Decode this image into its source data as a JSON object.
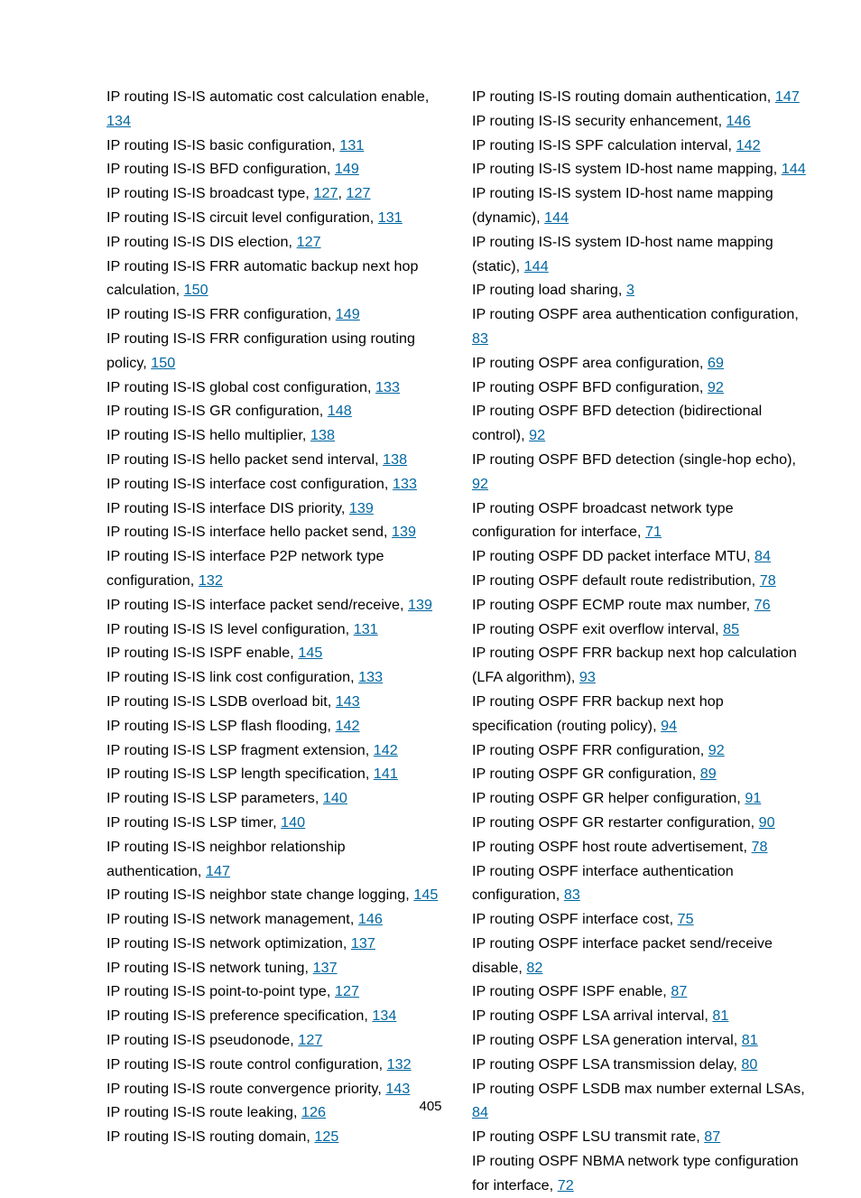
{
  "page_number": "405",
  "left": [
    {
      "text": "IP routing IS-IS automatic cost calculation enable, ",
      "refs": [
        "134"
      ]
    },
    {
      "text": "IP routing IS-IS basic configuration, ",
      "refs": [
        "131"
      ]
    },
    {
      "text": "IP routing IS-IS BFD configuration, ",
      "refs": [
        "149"
      ]
    },
    {
      "text": "IP routing IS-IS broadcast type, ",
      "refs": [
        "127",
        "127"
      ]
    },
    {
      "text": "IP routing IS-IS circuit level configuration, ",
      "refs": [
        "131"
      ]
    },
    {
      "text": "IP routing IS-IS DIS election, ",
      "refs": [
        "127"
      ]
    },
    {
      "text": "IP routing IS-IS FRR automatic backup next hop calculation, ",
      "refs": [
        "150"
      ]
    },
    {
      "text": "IP routing IS-IS FRR configuration, ",
      "refs": [
        "149"
      ]
    },
    {
      "text": "IP routing IS-IS FRR configuration using routing policy, ",
      "refs": [
        "150"
      ]
    },
    {
      "text": "IP routing IS-IS global cost configuration, ",
      "refs": [
        "133"
      ]
    },
    {
      "text": "IP routing IS-IS GR configuration, ",
      "refs": [
        "148"
      ]
    },
    {
      "text": "IP routing IS-IS hello multiplier, ",
      "refs": [
        "138"
      ]
    },
    {
      "text": "IP routing IS-IS hello packet send interval, ",
      "refs": [
        "138"
      ]
    },
    {
      "text": "IP routing IS-IS interface cost configuration, ",
      "refs": [
        "133"
      ]
    },
    {
      "text": "IP routing IS-IS interface DIS priority, ",
      "refs": [
        "139"
      ]
    },
    {
      "text": "IP routing IS-IS interface hello packet send, ",
      "refs": [
        "139"
      ]
    },
    {
      "text": "IP routing IS-IS interface P2P network type configuration, ",
      "refs": [
        "132"
      ]
    },
    {
      "text": "IP routing IS-IS interface packet send/receive, ",
      "refs": [
        "139"
      ]
    },
    {
      "text": "IP routing IS-IS IS level configuration, ",
      "refs": [
        "131"
      ]
    },
    {
      "text": "IP routing IS-IS ISPF enable, ",
      "refs": [
        "145"
      ]
    },
    {
      "text": "IP routing IS-IS link cost configuration, ",
      "refs": [
        "133"
      ]
    },
    {
      "text": "IP routing IS-IS LSDB overload bit, ",
      "refs": [
        "143"
      ]
    },
    {
      "text": "IP routing IS-IS LSP flash flooding, ",
      "refs": [
        "142"
      ]
    },
    {
      "text": "IP routing IS-IS LSP fragment extension, ",
      "refs": [
        "142"
      ]
    },
    {
      "text": "IP routing IS-IS LSP length specification, ",
      "refs": [
        "141"
      ]
    },
    {
      "text": "IP routing IS-IS LSP parameters, ",
      "refs": [
        "140"
      ]
    },
    {
      "text": "IP routing IS-IS LSP timer, ",
      "refs": [
        "140"
      ]
    },
    {
      "text": "IP routing IS-IS neighbor relationship authentication, ",
      "refs": [
        "147"
      ]
    },
    {
      "text": "IP routing IS-IS neighbor state change logging, ",
      "refs": [
        "145"
      ]
    },
    {
      "text": "IP routing IS-IS network management, ",
      "refs": [
        "146"
      ]
    },
    {
      "text": "IP routing IS-IS network optimization, ",
      "refs": [
        "137"
      ]
    },
    {
      "text": "IP routing IS-IS network tuning, ",
      "refs": [
        "137"
      ]
    },
    {
      "text": "IP routing IS-IS point-to-point type, ",
      "refs": [
        "127"
      ]
    },
    {
      "text": "IP routing IS-IS preference specification, ",
      "refs": [
        "134"
      ]
    },
    {
      "text": "IP routing IS-IS pseudonode, ",
      "refs": [
        "127"
      ]
    },
    {
      "text": "IP routing IS-IS route control configuration, ",
      "refs": [
        "132"
      ]
    },
    {
      "text": "IP routing IS-IS route convergence priority, ",
      "refs": [
        "143"
      ]
    },
    {
      "text": "IP routing IS-IS route leaking, ",
      "refs": [
        "126"
      ]
    },
    {
      "text": "IP routing IS-IS routing domain, ",
      "refs": [
        "125"
      ]
    }
  ],
  "right": [
    {
      "text": "IP routing IS-IS routing domain authentication, ",
      "refs": [
        "147"
      ]
    },
    {
      "text": "IP routing IS-IS security enhancement, ",
      "refs": [
        "146"
      ]
    },
    {
      "text": "IP routing IS-IS SPF calculation interval, ",
      "refs": [
        "142"
      ]
    },
    {
      "text": "IP routing IS-IS system ID-host name mapping, ",
      "refs": [
        "144"
      ]
    },
    {
      "text": "IP routing IS-IS system ID-host name mapping (dynamic), ",
      "refs": [
        "144"
      ]
    },
    {
      "text": "IP routing IS-IS system ID-host name mapping (static), ",
      "refs": [
        "144"
      ]
    },
    {
      "text": "IP routing load sharing, ",
      "refs": [
        "3"
      ]
    },
    {
      "text": "IP routing OSPF area authentication configuration, ",
      "refs": [
        "83"
      ]
    },
    {
      "text": "IP routing OSPF area configuration, ",
      "refs": [
        "69"
      ]
    },
    {
      "text": "IP routing OSPF BFD configuration, ",
      "refs": [
        "92"
      ]
    },
    {
      "text": "IP routing OSPF BFD detection (bidirectional control), ",
      "refs": [
        "92"
      ]
    },
    {
      "text": "IP routing OSPF BFD detection (single-hop echo), ",
      "refs": [
        "92"
      ]
    },
    {
      "text": "IP routing OSPF broadcast network type configuration for interface, ",
      "refs": [
        "71"
      ]
    },
    {
      "text": "IP routing OSPF DD packet interface MTU, ",
      "refs": [
        "84"
      ]
    },
    {
      "text": "IP routing OSPF default route redistribution, ",
      "refs": [
        "78"
      ]
    },
    {
      "text": "IP routing OSPF ECMP route max number, ",
      "refs": [
        "76"
      ]
    },
    {
      "text": "IP routing OSPF exit overflow interval, ",
      "refs": [
        "85"
      ]
    },
    {
      "text": "IP routing OSPF FRR backup next hop calculation (LFA algorithm), ",
      "refs": [
        "93"
      ]
    },
    {
      "text": "IP routing OSPF FRR backup next hop specification (routing policy), ",
      "refs": [
        "94"
      ]
    },
    {
      "text": "IP routing OSPF FRR configuration, ",
      "refs": [
        "92"
      ]
    },
    {
      "text": "IP routing OSPF GR configuration, ",
      "refs": [
        "89"
      ]
    },
    {
      "text": "IP routing OSPF GR helper configuration, ",
      "refs": [
        "91"
      ]
    },
    {
      "text": "IP routing OSPF GR restarter configuration, ",
      "refs": [
        "90"
      ]
    },
    {
      "text": "IP routing OSPF host route advertisement, ",
      "refs": [
        "78"
      ]
    },
    {
      "text": "IP routing OSPF interface authentication configuration, ",
      "refs": [
        "83"
      ]
    },
    {
      "text": "IP routing OSPF interface cost, ",
      "refs": [
        "75"
      ]
    },
    {
      "text": "IP routing OSPF interface packet send/receive disable, ",
      "refs": [
        "82"
      ]
    },
    {
      "text": "IP routing OSPF ISPF enable, ",
      "refs": [
        "87"
      ]
    },
    {
      "text": "IP routing OSPF LSA arrival interval, ",
      "refs": [
        "81"
      ]
    },
    {
      "text": "IP routing OSPF LSA generation interval, ",
      "refs": [
        "81"
      ]
    },
    {
      "text": "IP routing OSPF LSA transmission delay, ",
      "refs": [
        "80"
      ]
    },
    {
      "text": "IP routing OSPF LSDB max number external LSAs, ",
      "refs": [
        "84"
      ]
    },
    {
      "text": "IP routing OSPF LSU transmit rate, ",
      "refs": [
        "87"
      ]
    },
    {
      "text": "IP routing OSPF NBMA network type configuration for interface, ",
      "refs": [
        "72"
      ]
    }
  ]
}
